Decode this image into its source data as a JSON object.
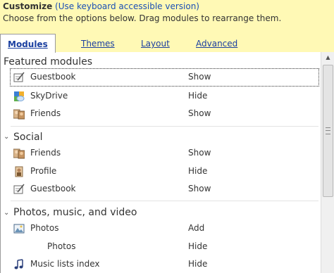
{
  "header": {
    "title": "Customize",
    "keyboard_link": "(Use keyboard accessible version)",
    "subtitle": "Choose from the options below. Drag modules to rearrange them."
  },
  "tabs": [
    {
      "label": "Modules",
      "active": true
    },
    {
      "label": "Themes",
      "active": false
    },
    {
      "label": "Layout",
      "active": false
    },
    {
      "label": "Advanced",
      "active": false
    }
  ],
  "groups": {
    "featured": {
      "title": "Featured modules",
      "items": [
        {
          "name": "Guestbook",
          "status": "Show",
          "icon": "guestbook-icon"
        },
        {
          "name": "SkyDrive",
          "status": "Hide",
          "icon": "skydrive-icon"
        },
        {
          "name": "Friends",
          "status": "Show",
          "icon": "friends-icon"
        }
      ]
    },
    "social": {
      "title": "Social",
      "items": [
        {
          "name": "Friends",
          "status": "Show",
          "icon": "friends-icon"
        },
        {
          "name": "Profile",
          "status": "Hide",
          "icon": "profile-icon"
        },
        {
          "name": "Guestbook",
          "status": "Show",
          "icon": "guestbook-icon"
        }
      ]
    },
    "photos": {
      "title": "Photos, music, and video",
      "items": [
        {
          "name": "Photos",
          "status": "Add",
          "icon": "photos-icon"
        },
        {
          "name": "Photos",
          "status": "Hide",
          "icon": ""
        },
        {
          "name": "Music lists index",
          "status": "Hide",
          "icon": "music-note-icon"
        }
      ]
    }
  }
}
